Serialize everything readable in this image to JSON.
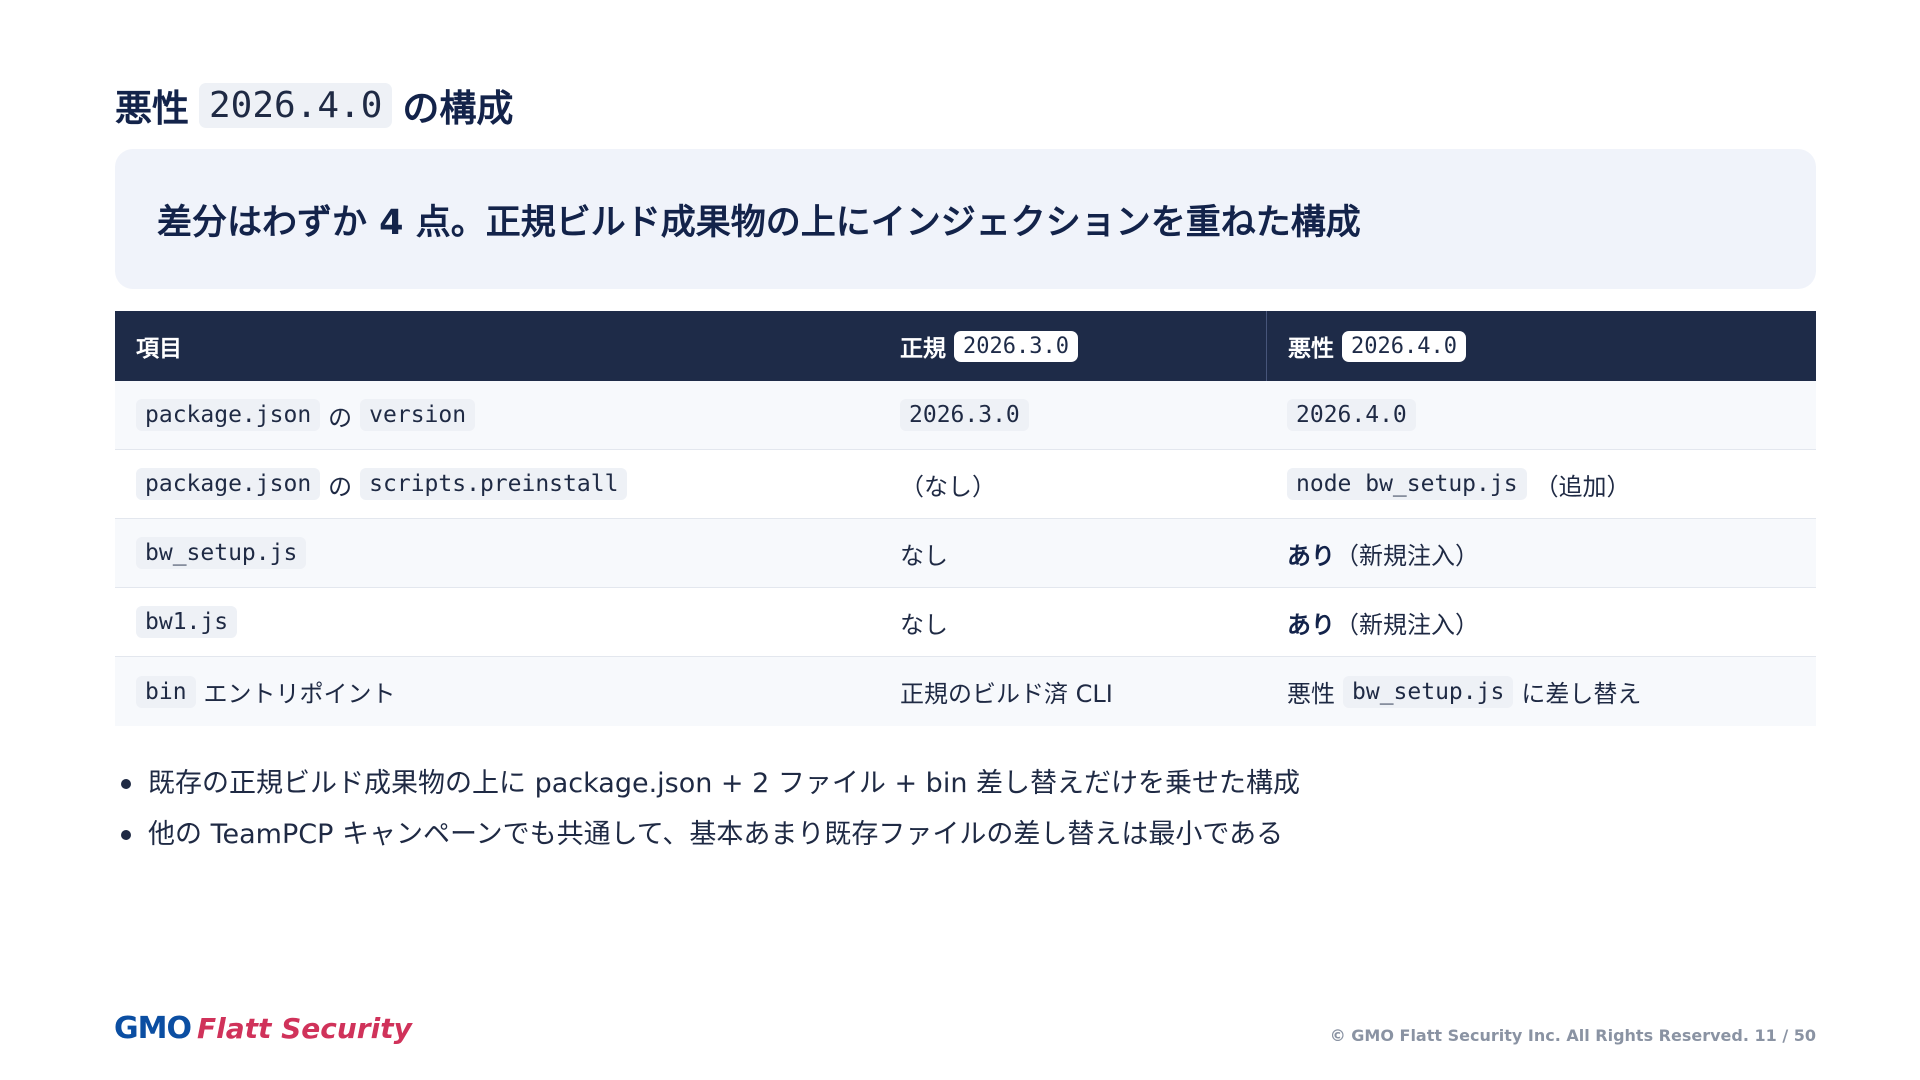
{
  "title": {
    "prefix": "悪性",
    "version": "2026.4.0",
    "suffix": "の構成"
  },
  "callout": "差分はわずか 4 点。正規ビルド成果物の上にインジェクションを重ねた構成",
  "table": {
    "headers": {
      "item": "項目",
      "legit_label": "正規",
      "legit_version": "2026.3.0",
      "malicious_label": "悪性",
      "malicious_version": "2026.4.0"
    },
    "rows": [
      {
        "item": {
          "code1": "package.json",
          "mid": "の",
          "code2": "version"
        },
        "legit": {
          "code": "2026.3.0"
        },
        "malicious": {
          "code": "2026.4.0"
        }
      },
      {
        "item": {
          "code1": "package.json",
          "mid": "の",
          "code2": "scripts.preinstall"
        },
        "legit": {
          "text": "（なし）"
        },
        "malicious": {
          "code": "node bw_setup.js",
          "text": "（追加）"
        }
      },
      {
        "item": {
          "code1": "bw_setup.js"
        },
        "legit": {
          "text": "なし"
        },
        "malicious": {
          "bold": "あり",
          "text": "（新規注入）"
        }
      },
      {
        "item": {
          "code1": "bw1.js"
        },
        "legit": {
          "text": "なし"
        },
        "malicious": {
          "bold": "あり",
          "text": "（新規注入）"
        }
      },
      {
        "item": {
          "code1": "bin",
          "text": "エントリポイント"
        },
        "legit": {
          "text": "正規のビルド済 CLI"
        },
        "malicious": {
          "pre": "悪性",
          "code": "bw_setup.js",
          "text": "に差し替え"
        }
      }
    ]
  },
  "bullets": [
    "既存の正規ビルド成果物の上に package.json + 2 ファイル + bin 差し替えだけを乗せた構成",
    "他の TeamPCP キャンペーンでも共通して、基本あまり既存ファイルの差し替えは最小である"
  ],
  "logo": {
    "gmo": "GMO",
    "brand": "Flatt Security"
  },
  "footer": "© GMO Flatt Security Inc. All Rights Reserved. 11 / 50",
  "colors": {
    "navy": "#1e2b48",
    "accent": "#d0325a",
    "brand_blue": "#0b4ea2"
  }
}
